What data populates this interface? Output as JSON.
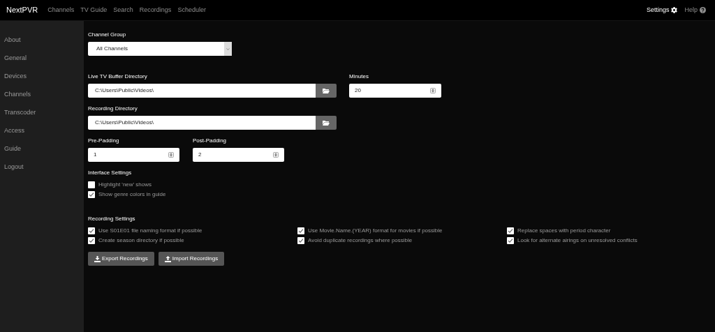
{
  "navbar": {
    "brand": "NextPVR",
    "links": [
      {
        "label": "Channels"
      },
      {
        "label": "TV Guide"
      },
      {
        "label": "Search"
      },
      {
        "label": "Recordings"
      },
      {
        "label": "Scheduler"
      }
    ],
    "right_links": [
      {
        "label": "Settings",
        "kind": "settings",
        "selected": true
      },
      {
        "label": "Help",
        "kind": "help",
        "selected": false
      }
    ]
  },
  "sidebar": {
    "items": [
      "About",
      "General",
      "Devices",
      "Channels",
      "Transcoder",
      "Access",
      "Guide",
      "Logout"
    ]
  },
  "channel_group": {
    "label": "Channel Group",
    "value": "All Channels"
  },
  "live_tv_buffer_directory": {
    "label": "Live TV Buffer Directory",
    "value": "C:\\Users\\Public\\Videos\\"
  },
  "minutes": {
    "label": "Minutes",
    "value": "20"
  },
  "recording_directory": {
    "label": "Recording Directory",
    "value": "C:\\Users\\Public\\Videos\\"
  },
  "pre_padding": {
    "label": "Pre-Padding",
    "value": "1"
  },
  "post_padding": {
    "label": "Post-Padding",
    "value": "2"
  },
  "interface_settings": {
    "title": "Interface Settings",
    "options": [
      {
        "label": "Highlight 'new' shows",
        "checked": false
      },
      {
        "label": "Show genre colors in guide",
        "checked": true
      }
    ]
  },
  "recording_settings": {
    "title": "Recording Settings",
    "options": [
      {
        "label": "Use S01E01 file naming format if possible",
        "checked": true
      },
      {
        "label": "Use Movie.Name.(YEAR) format for movies if possible",
        "checked": true
      },
      {
        "label": "Replace spaces with period character",
        "checked": true
      },
      {
        "label": "Create season directory if possible",
        "checked": true
      },
      {
        "label": "Avoid duplicate recordings where possible",
        "checked": true
      },
      {
        "label": "Look for alternate airings on unresolved conflicts",
        "checked": true
      }
    ]
  },
  "buttons": [
    {
      "label": "Export Recordings",
      "kind": "export"
    },
    {
      "label": "Import Recordings",
      "kind": "import"
    }
  ]
}
